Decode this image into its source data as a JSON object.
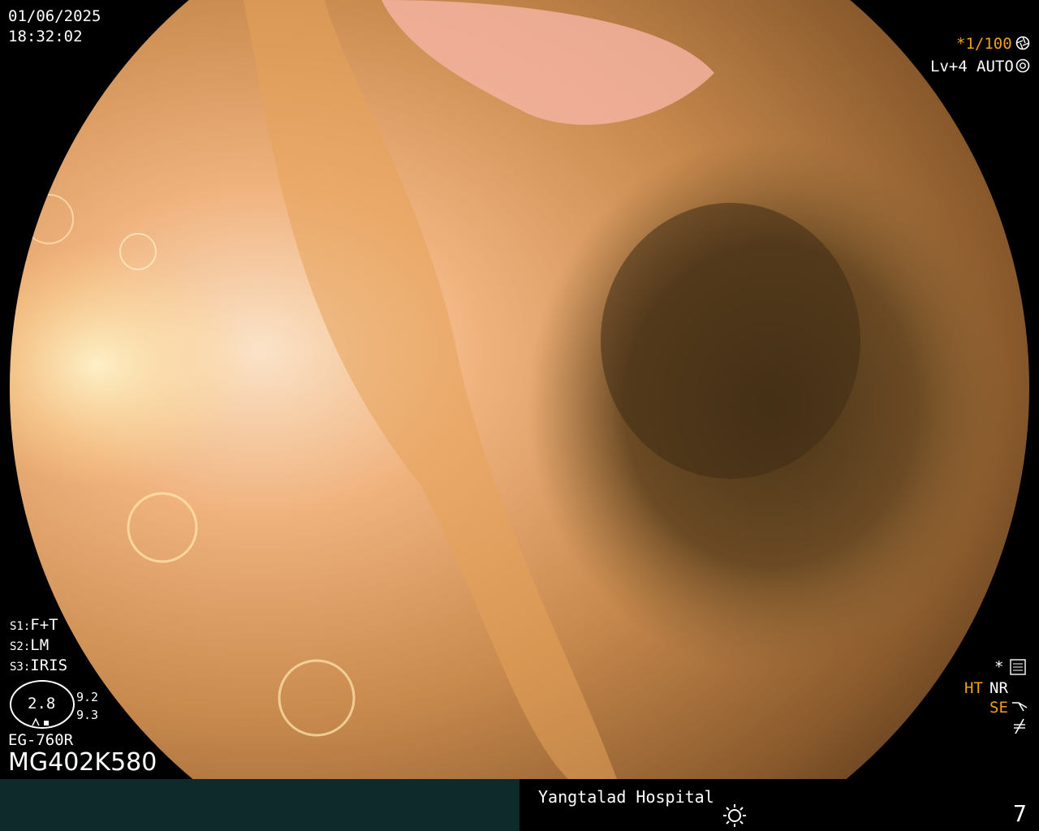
{
  "datetime": {
    "date": "01/06/2025",
    "time": "18:32:02"
  },
  "top_right": {
    "shutter": "*1/100",
    "level": "Lv+4",
    "mode": "AUTO"
  },
  "settings": {
    "s1_label": "S1:",
    "s1_value": "F+T",
    "s2_label": "S2:",
    "s2_value": "LM",
    "s3_label": "S3:",
    "s3_value": "IRIS"
  },
  "scope": {
    "magnification": "2.8",
    "value_a": "9.2",
    "value_b": "9.3",
    "model": "EG-760R",
    "serial": "MG402K580"
  },
  "right_status": {
    "star": "*",
    "ht": "HT",
    "nr": "NR",
    "se": "SE"
  },
  "footer": {
    "hospital": "Yangtalad Hospital",
    "frame_number": "7"
  },
  "colors": {
    "accent": "#f0a01a",
    "bottom_bar": "#0f2a2a",
    "tissue_light": "#f2b88a",
    "tissue_dark": "#5a3c1c"
  }
}
